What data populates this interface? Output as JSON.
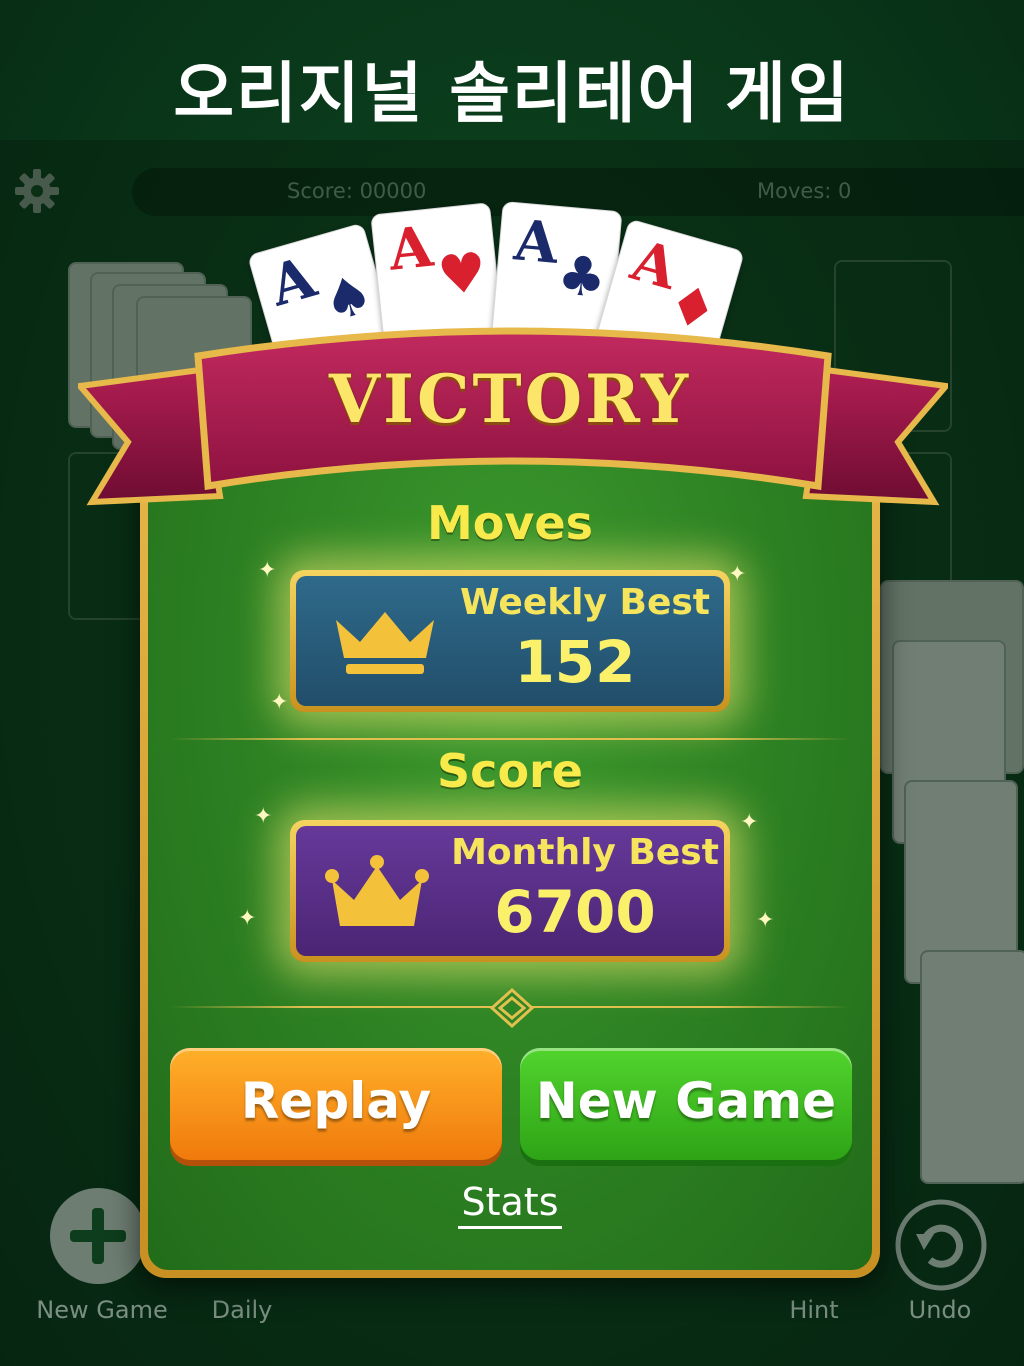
{
  "headline": "오리지널 솔리테어 게임",
  "status_bar": {
    "score": "Score: 00000",
    "moves": "Moves: 0",
    "settings_icon": "gear-icon"
  },
  "victory": {
    "title": "VICTORY",
    "cards": [
      {
        "rank": "A",
        "suit": "♠",
        "color": "#1b2a6b"
      },
      {
        "rank": "A",
        "suit": "♥",
        "color": "#d8202e"
      },
      {
        "rank": "A",
        "suit": "♣",
        "color": "#1b2a6b"
      },
      {
        "rank": "A",
        "suit": "♦",
        "color": "#d8202e"
      }
    ],
    "moves_section": {
      "title": "Moves",
      "label": "Weekly Best",
      "value": "152",
      "icon": "crown-icon",
      "box_color": "#2b5f7e"
    },
    "score_section": {
      "title": "Score",
      "label": "Monthly Best",
      "value": "6700",
      "icon": "crown-icon",
      "box_color": "#5b2f86"
    },
    "replay_label": "Replay",
    "new_game_label": "New Game",
    "stats_label": "Stats"
  },
  "bottom_bar": {
    "new_game": "New Game",
    "daily": "Daily",
    "hint": "Hint",
    "undo": "Undo"
  }
}
